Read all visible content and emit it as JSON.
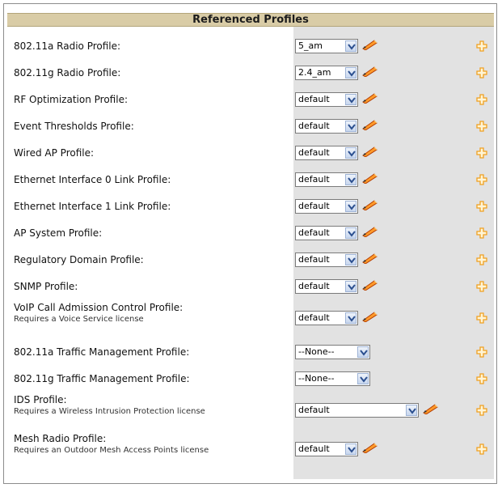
{
  "header": {
    "title": "Referenced Profiles"
  },
  "rows": [
    {
      "label": "802.11a Radio Profile:",
      "value": "5_am",
      "note": ""
    },
    {
      "label": "802.11g Radio Profile:",
      "value": "2.4_am",
      "note": ""
    },
    {
      "label": "RF Optimization Profile:",
      "value": "default",
      "note": ""
    },
    {
      "label": "Event Thresholds Profile:",
      "value": "default",
      "note": ""
    },
    {
      "label": "Wired AP Profile:",
      "value": "default",
      "note": ""
    },
    {
      "label": "Ethernet Interface 0 Link Profile:",
      "value": "default",
      "note": ""
    },
    {
      "label": "Ethernet Interface 1 Link Profile:",
      "value": "default",
      "note": ""
    },
    {
      "label": "AP System Profile:",
      "value": "default",
      "note": ""
    },
    {
      "label": "Regulatory Domain Profile:",
      "value": "default",
      "note": ""
    },
    {
      "label": "SNMP Profile:",
      "value": "default",
      "note": ""
    },
    {
      "label": "VoIP Call Admission Control Profile:",
      "value": "default",
      "note": "Requires a Voice Service license"
    },
    {
      "label": "802.11a Traffic Management Profile:",
      "value": "--None--",
      "note": ""
    },
    {
      "label": "802.11g Traffic Management Profile:",
      "value": "--None--",
      "note": ""
    },
    {
      "label": "IDS Profile:",
      "value": "default",
      "note": "Requires a Wireless Intrusion Protection license"
    },
    {
      "label": "Mesh Radio Profile:",
      "value": "default",
      "note": "Requires an Outdoor Mesh Access Points license"
    }
  ],
  "icons": {
    "edit": "pencil-icon",
    "add": "plus-icon",
    "dropdown": "chevron-down-icon"
  },
  "colors": {
    "header_bg": "#d9cca6",
    "column_bg": "#e2e2e2",
    "plus": "#f0a020",
    "pencil": "#e05a10"
  }
}
